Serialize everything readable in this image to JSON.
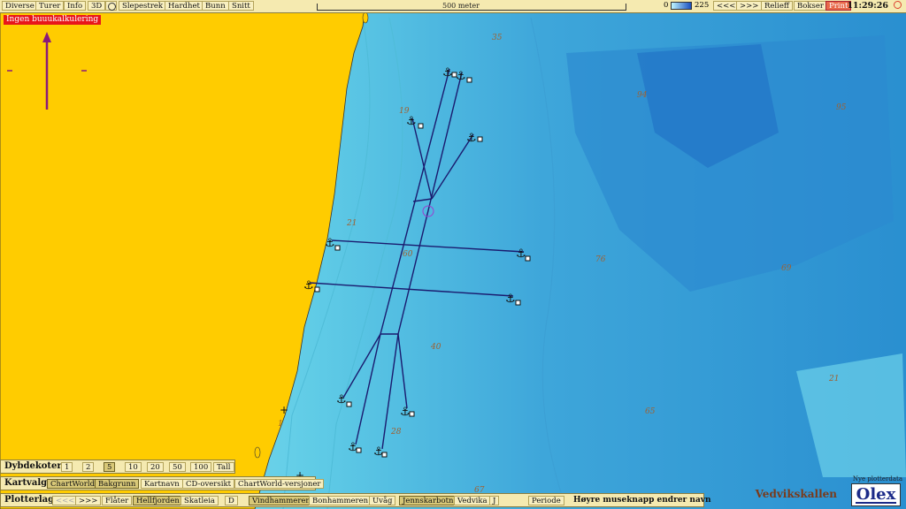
{
  "toolbar": {
    "items": [
      "Diverse",
      "Turer",
      "Info",
      "3D",
      "Slepestrek",
      "Hardhet",
      "Bunn",
      "Snitt"
    ],
    "scale_label": "500 meter",
    "depth_min": "0",
    "depth_max": "225",
    "prev": "<<<",
    "next": ">>>",
    "relieff": "Relieff",
    "bokser": "Bokser",
    "print": "Print",
    "clock": "11:29:26"
  },
  "warning": "Ingen buuukalkulering",
  "map": {
    "depth_labels": [
      "35",
      "94",
      "95",
      "19",
      "21",
      "60",
      "76",
      "69",
      "40",
      "65",
      "21",
      "28",
      "1",
      "67"
    ]
  },
  "dybdekoter": {
    "label": "Dybdekoter",
    "options": [
      "1",
      "2",
      "5",
      "10",
      "20",
      "50",
      "100",
      "Tall"
    ],
    "selected": "5"
  },
  "kartvalg": {
    "label": "Kartvalg",
    "options": [
      "ChartWorld",
      "Bakgrunn",
      "Kartnavn",
      "CD-oversikt",
      "ChartWorld-versjoner"
    ]
  },
  "plotterlag": {
    "label": "Plotterlag",
    "prev": "<<<",
    "next": ">>>",
    "options": [
      "Flåter",
      "Hellfjorden",
      "Skatleia",
      "D",
      "Vindhammeren",
      "Bonhammeren",
      "Uvåg",
      "Jennskarbotn",
      "Vedvika",
      "J",
      "Periode"
    ],
    "hint": "Høyre museknapp endrer navn"
  },
  "status": {
    "place": "Vedvikskallen",
    "nyplotter": "Nye plotterdata",
    "brand": "Olex"
  },
  "colors": {
    "land": "#ffcc00",
    "track": "#1a1a6e",
    "warning_bg": "#e8151a"
  }
}
